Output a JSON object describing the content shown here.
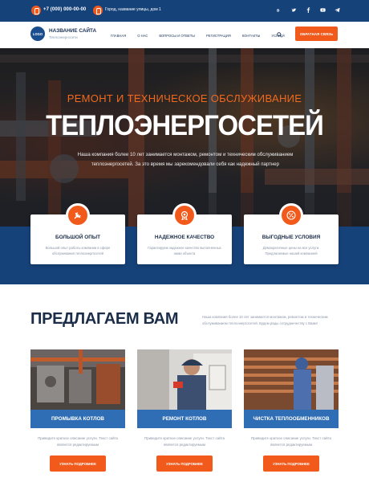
{
  "topbar": {
    "phone": "+7 (000) 000-00-00",
    "address": "Город, название улицы, дом 1",
    "socials": [
      "vk-icon",
      "twitter-icon",
      "facebook-icon",
      "youtube-icon",
      "telegram-icon"
    ]
  },
  "header": {
    "logo_text": "LOGO",
    "site_title": "НАЗВАНИЕ САЙТА",
    "site_subtitle": "Теплоэнергосети",
    "nav": [
      "ГЛАВНАЯ",
      "О НАС",
      "ВОПРОСЫ И ОТВЕТЫ",
      "РЕГИСТРАЦИЯ",
      "КОНТАКТЫ",
      "УСЛУГИ"
    ],
    "callback_label": "ОБРАТНАЯ СВЯЗЬ"
  },
  "hero": {
    "kicker": "РЕМОНТ И ТЕХНИЧЕСКОЕ ОБСЛУЖИВАНИЕ",
    "title": "ТЕПЛОЭНЕРГОСЕТЕЙ",
    "text": "Наша компания более 10 лет занимается монтажом, ремонтом и техническим обслуживанием теплоэнергосетей. За это время мы зарекомендовали себя как надежный партнер"
  },
  "features": [
    {
      "icon": "tools-icon",
      "title": "БОЛЬШОЙ ОПЫТ",
      "text": "Большой опыт работы компании в сфере обслуживания теплоэнергосетей"
    },
    {
      "icon": "medal-icon",
      "title": "НАДЕЖНОЕ КАЧЕСТВО",
      "text": "Гарантируем надежное качество выполненных нами объекта"
    },
    {
      "icon": "percent-icon",
      "title": "ВЫГОДНЫЕ УСЛОВИЯ",
      "text": "Демократичные цены на все услуги. Предлагаемые нашей компанией"
    }
  ],
  "offer": {
    "title": "ПРЕДЛАГАЕМ ВАМ",
    "text": "Наша компания более 10 лет занимается монтажом, ремонтом и техническим обслуживанием теплоэнергосетей. Будем рады сотрудничеству с Вами!"
  },
  "services": [
    {
      "title": "ПРОМЫВКА КОТЛОВ",
      "text": "Приведите краткое описание услуги. Текст сайта является редактируемым",
      "button": "УЗНАТЬ ПОДРОБНЕЕ"
    },
    {
      "title": "РЕМОНТ КОТЛОВ",
      "text": "Приведите краткое описание услуги. Текст сайта является редактируемым",
      "button": "УЗНАТЬ ПОДРОБНЕЕ"
    },
    {
      "title": "ЧИСТКА ТЕПЛООБМЕННИКОВ",
      "text": "Приведите краткое описание услуги. Текст сайта является редактируемым",
      "button": "УЗНАТЬ ПОДРОБНЕЕ"
    }
  ],
  "colors": {
    "primary": "#16427a",
    "accent": "#f25a1c",
    "service_bar": "#2f6db4"
  }
}
